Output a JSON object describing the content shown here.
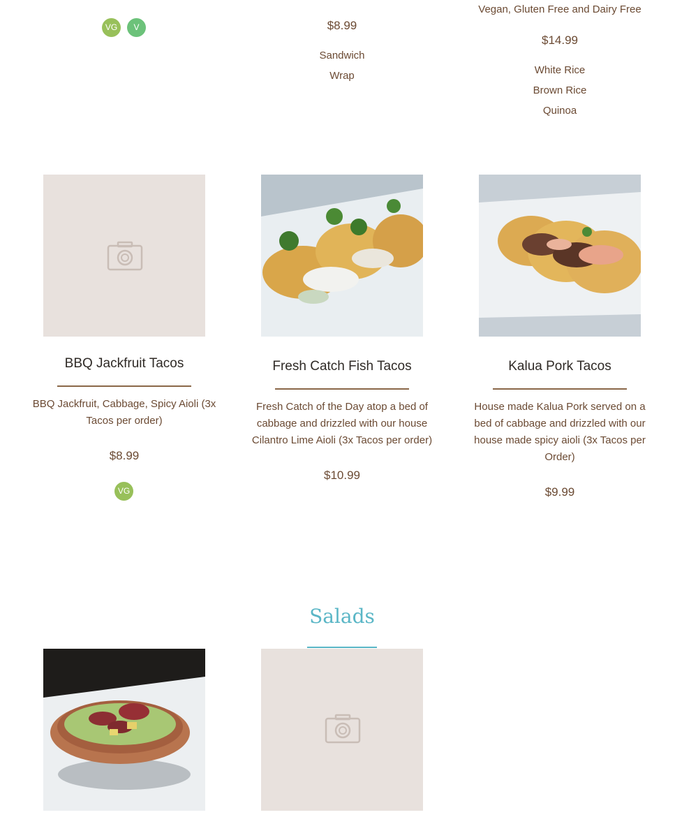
{
  "top": {
    "col1_badges": [
      "VG",
      "V"
    ],
    "col2": {
      "price": "$8.99",
      "options": [
        "Sandwich",
        "Wrap"
      ]
    },
    "col3": {
      "note": "Vegan, Gluten Free and Dairy Free",
      "price": "$14.99",
      "options": [
        "White Rice",
        "Brown Rice",
        "Quinoa"
      ]
    }
  },
  "items": [
    {
      "title": "BBQ Jackfruit Tacos",
      "description": "BBQ Jackfruit, Cabbage, Spicy Aioli (3x Tacos per order)",
      "price": "$8.99",
      "badge": "VG"
    },
    {
      "title": "Fresh Catch Fish Tacos",
      "description": "Fresh Catch of the Day atop a bed of cabbage and drizzled with our house Cilantro Lime Aioli (3x Tacos per order)",
      "price": "$10.99"
    },
    {
      "title": "Kalua Pork Tacos",
      "description": "House made Kalua Pork served on a bed of cabbage and drizzled with our house made spicy aioli (3x Tacos per Order)",
      "price": "$9.99"
    }
  ],
  "salads": {
    "heading": "Salads"
  },
  "colors": {
    "accent_brown": "#8a6748",
    "salads_teal": "#5ab6c6",
    "placeholder": "#e8e1dd",
    "badge_vg": "#98c05a",
    "badge_v": "#6cc27a"
  }
}
